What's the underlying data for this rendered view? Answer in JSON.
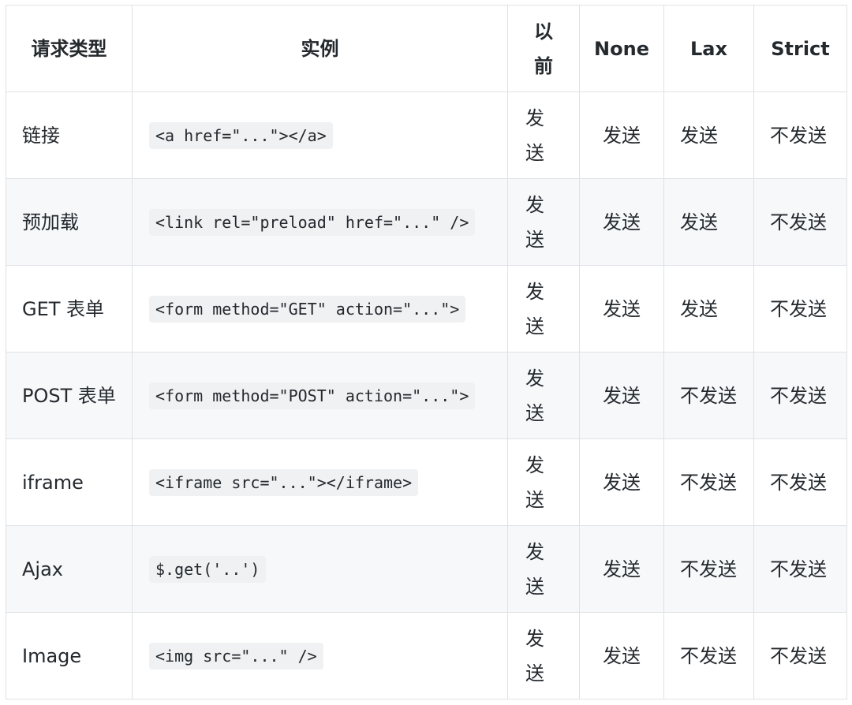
{
  "headers": {
    "type": "请求类型",
    "example": "实例",
    "before": "以前",
    "none": "None",
    "lax": "Lax",
    "strict": "Strict"
  },
  "rows": [
    {
      "type": "链接",
      "example": "<a href=\"...\"></a>",
      "before": "发送",
      "none": "发送",
      "lax": "发送",
      "strict": "不发送"
    },
    {
      "type": "预加载",
      "example": "<link rel=\"preload\" href=\"...\" />",
      "before": "发送",
      "none": "发送",
      "lax": "发送",
      "strict": "不发送"
    },
    {
      "type": "GET 表单",
      "example": "<form method=\"GET\" action=\"...\">",
      "before": "发送",
      "none": "发送",
      "lax": "发送",
      "strict": "不发送"
    },
    {
      "type": "POST 表单",
      "example": "<form method=\"POST\" action=\"...\">",
      "before": "发送",
      "none": "发送",
      "lax": "不发送",
      "strict": "不发送"
    },
    {
      "type": "iframe",
      "example": "<iframe src=\"...\"></iframe>",
      "before": "发送",
      "none": "发送",
      "lax": "不发送",
      "strict": "不发送"
    },
    {
      "type": "Ajax",
      "example": "$.get('..')",
      "before": "发送",
      "none": "发送",
      "lax": "不发送",
      "strict": "不发送"
    },
    {
      "type": "Image",
      "example": "<img src=\"...\" />",
      "before": "发送",
      "none": "发送",
      "lax": "不发送",
      "strict": "不发送"
    }
  ]
}
